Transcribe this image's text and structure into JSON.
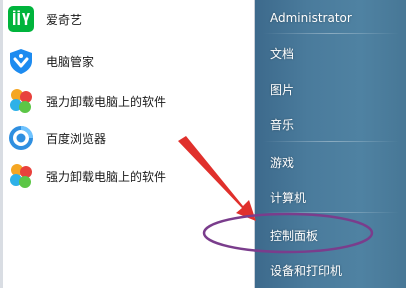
{
  "programs": [
    {
      "label": "爱奇艺",
      "icon": "iqiyi-icon"
    },
    {
      "label": "电脑管家",
      "icon": "pc-manager-shield-icon"
    },
    {
      "label": "强力卸载电脑上的软件",
      "icon": "uninstaller-flower-icon"
    },
    {
      "label": "百度浏览器",
      "icon": "baidu-browser-icon"
    },
    {
      "label": "强力卸载电脑上的软件",
      "icon": "uninstaller-flower-icon"
    }
  ],
  "right_panel": {
    "user": "Administrator",
    "items": [
      "文档",
      "图片",
      "音乐",
      "游戏",
      "计算机",
      "控制面板",
      "设备和打印机"
    ]
  },
  "annotation": {
    "arrow_color": "#e0302c",
    "ellipse_color": "#7a3d8c",
    "highlighted_item": "控制面板"
  },
  "colors": {
    "right_panel": "#4a7b9c",
    "iqiyi_green": "#00b43c",
    "pc_manager_blue": "#1d8bf0"
  }
}
